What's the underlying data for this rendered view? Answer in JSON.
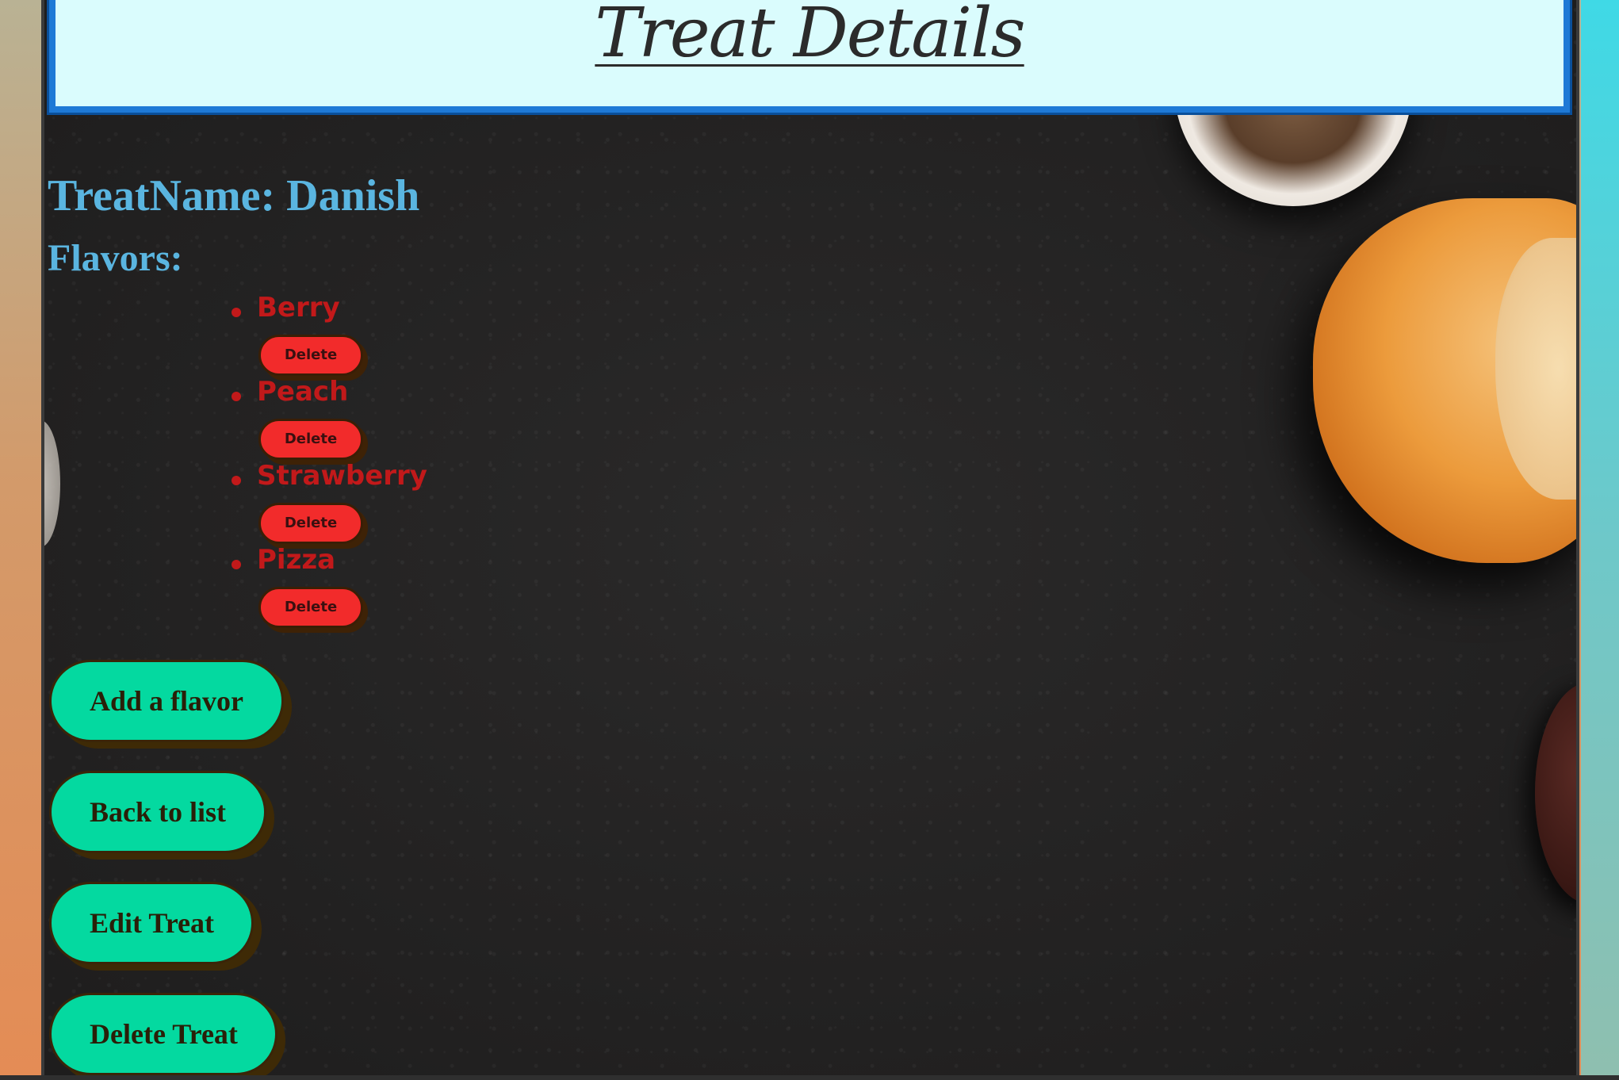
{
  "header": {
    "title": "Treat Details"
  },
  "treat": {
    "name_line": "TreatName: Danish",
    "flavors_label": "Flavors:"
  },
  "flavors": [
    {
      "name": "Berry",
      "delete_label": "Delete"
    },
    {
      "name": "Peach",
      "delete_label": "Delete"
    },
    {
      "name": "Strawberry",
      "delete_label": "Delete"
    },
    {
      "name": "Pizza",
      "delete_label": "Delete"
    }
  ],
  "actions": {
    "add_flavor": "Add a flavor",
    "back_to_list": "Back to list",
    "edit_treat": "Edit Treat",
    "delete_treat": "Delete Treat"
  },
  "colors": {
    "header_bg": "#dafcfd",
    "header_border": "#1e79d6",
    "heading_text": "#5ab5e0",
    "flavor_text": "#c2191a",
    "delete_button": "#f22b2b",
    "action_button": "#04d9a0"
  }
}
